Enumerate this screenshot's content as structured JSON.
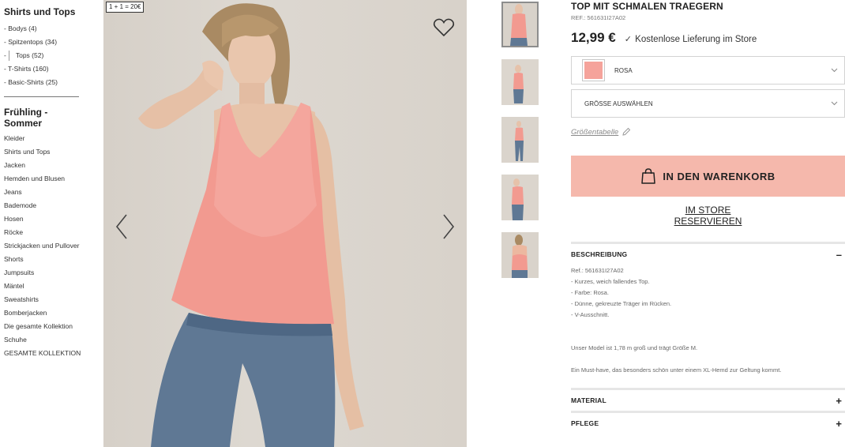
{
  "sidebar": {
    "heading": "Shirts und Tops",
    "subcats": [
      {
        "label": "- Bodys (4)"
      },
      {
        "label": "- Spitzentops (34)"
      },
      {
        "prefix": "-",
        "label": "Tops (52)"
      },
      {
        "label": "- T-Shirts (160)"
      },
      {
        "label": "- Basic-Shirts (25)"
      }
    ],
    "season_title_1": "Frühling -",
    "season_title_2": "Sommer",
    "categories": [
      "Kleider",
      "Shirts und Tops",
      "Jacken",
      "Hemden und Blusen",
      "Jeans",
      "Bademode",
      "Hosen",
      "Röcke",
      "Strickjacken und Pullover",
      "Shorts",
      "Jumpsuits",
      "Mäntel",
      "Sweatshirts",
      "Bomberjacken",
      "Die gesamte Kollektion",
      "Schuhe",
      "GESAMTE KOLLEKTION"
    ]
  },
  "gallery": {
    "promo_badge": "1 + 1 = 20€",
    "favorite_icon": "heart-icon",
    "prev_icon": "chevron-left-icon",
    "next_icon": "chevron-right-icon",
    "thumbnail_count": 5,
    "selected_thumbnail": 1
  },
  "product": {
    "title": "TOP MIT SCHMALEN TRAEGERN",
    "ref": "REF.: 561631I27A02",
    "price": "12,99 €",
    "shipping_check": "✓",
    "shipping": "Kostenlose Lieferung im Store",
    "color": {
      "label": "ROSA",
      "swatch": "#f5a39b"
    },
    "size_placeholder": "GRÖSSE AUSWÄHLEN",
    "size_chart": "Größentabelle",
    "cart_button": "IN DEN WARENKORB",
    "cart_color": "#f5b8ac",
    "reserve": "IM STORE RESERVIEREN"
  },
  "description": {
    "title": "BESCHREIBUNG",
    "toggle": "–",
    "lines": [
      "Ref.: 561631I27A02",
      "- Kurzes, weich fallendes Top.",
      "- Farbe: Rosa.",
      "- Dünne, gekreuzte Träger im Rücken.",
      "- V-Ausschnitt."
    ],
    "model_note": "Unser Model ist 1,78 m groß und trägt Größe M.",
    "note": "Ein Must-have, das besonders schön unter einem XL-Hemd zur Geltung kommt."
  },
  "material": {
    "title": "MATERIAL",
    "toggle": "+"
  },
  "care": {
    "title": "PFLEGE",
    "toggle": "+"
  }
}
